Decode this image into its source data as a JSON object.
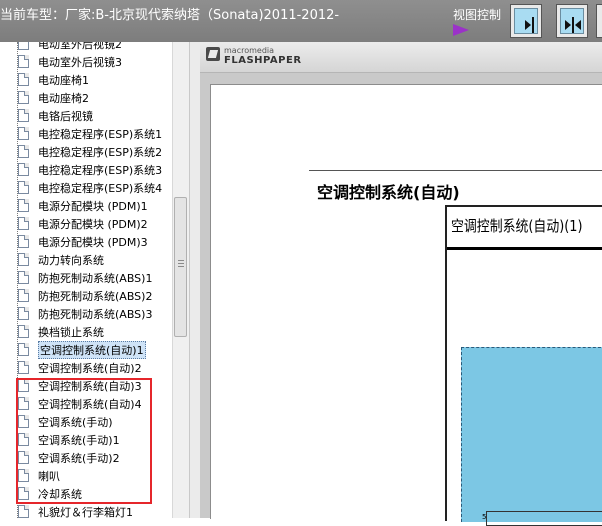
{
  "header": {
    "title": "当前车型：厂家:B-北京现代索纳塔（Sonata)2011-2012-",
    "view_control_label": "视图控制",
    "buttons": [
      {
        "name": "single-page",
        "icon": "single-page-icon"
      },
      {
        "name": "two-page",
        "icon": "two-page-icon"
      },
      {
        "name": "fit",
        "icon": "fit-icon"
      }
    ]
  },
  "sidebar": {
    "items": [
      {
        "label": "电动室外后视镜2"
      },
      {
        "label": "电动室外后视镜3"
      },
      {
        "label": "电动座椅1"
      },
      {
        "label": "电动座椅2"
      },
      {
        "label": "电铬后视镜"
      },
      {
        "label": "电控稳定程序(ESP)系统1"
      },
      {
        "label": "电控稳定程序(ESP)系统2"
      },
      {
        "label": "电控稳定程序(ESP)系统3"
      },
      {
        "label": "电控稳定程序(ESP)系统4"
      },
      {
        "label": "电源分配模块 (PDM)1"
      },
      {
        "label": "电源分配模块 (PDM)2"
      },
      {
        "label": "电源分配模块 (PDM)3"
      },
      {
        "label": "动力转向系统"
      },
      {
        "label": "防抱死制动系统(ABS)1"
      },
      {
        "label": "防抱死制动系统(ABS)2"
      },
      {
        "label": "防抱死制动系统(ABS)3"
      },
      {
        "label": "换档锁止系统"
      },
      {
        "label": "空调控制系统(自动)1",
        "selected": true
      },
      {
        "label": "空调控制系统(自动)2"
      },
      {
        "label": "空调控制系统(自动)3"
      },
      {
        "label": "空调控制系统(自动)4"
      },
      {
        "label": "空调系统(手动)"
      },
      {
        "label": "空调系统(手动)1"
      },
      {
        "label": "空调系统(手动)2"
      },
      {
        "label": "喇叭"
      },
      {
        "label": "冷却系统"
      },
      {
        "label": "礼貌灯＆行李箱灯1"
      }
    ]
  },
  "viewer": {
    "logo_top": "macromedia",
    "logo_bottom": "FLASHPAPER",
    "doc_heading": "空调控制系统(自动)",
    "doc_subtitle": "空调控制系统(自动)(1)",
    "diagram_number": "5"
  },
  "colors": {
    "header_bg": "#858585",
    "highlight_box": "#e5262b",
    "diagram_bg": "#7cc7e4",
    "play_icon": "#9b32c8"
  }
}
